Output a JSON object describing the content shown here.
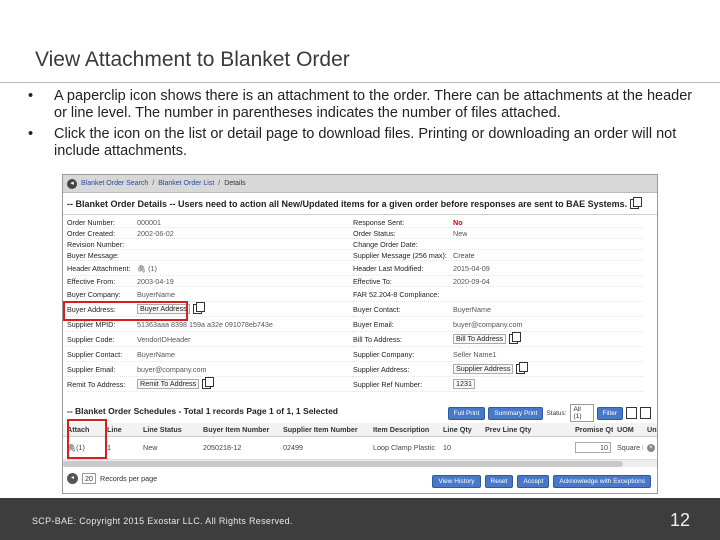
{
  "slide": {
    "title": "View Attachment to Blanket Order",
    "bullets": [
      "A paperclip icon shows there is an attachment to the order.  There can be attachments at the header or line level.  The number in parentheses indicates the number of files attached.",
      "Click the icon on the list or detail page to download files.  Printing or downloading an order will not include attachments."
    ],
    "footer": "SCP-BAE:  Copyright 2015 Exostar LLC. All Rights Reserved.",
    "page_number": "12"
  },
  "app": {
    "breadcrumb": [
      "Blanket Order Search",
      "Blanket Order List",
      "Details"
    ],
    "header_title": "-- Blanket Order Details -- Users need to action all New/Updated items for a given order before responses are sent to BAE Systems.",
    "left_fields": [
      {
        "label": "Order Number:",
        "value": "000001"
      },
      {
        "label": "Order Created:",
        "value": "2002-06-02"
      },
      {
        "label": "Revision Number:",
        "value": ""
      },
      {
        "label": "Buyer Message:",
        "value": ""
      },
      {
        "label": "Header Attachment:",
        "value": "(1)"
      },
      {
        "label": "Effective From:",
        "value": "2003-04-19"
      },
      {
        "label": "Buyer Company:",
        "value": "BuyerName"
      },
      {
        "label": "Buyer Address:",
        "value": "Buyer Address"
      },
      {
        "label": "Supplier MPID:",
        "value": "51363aaa 8398 159a a32e 091078eb743e"
      },
      {
        "label": "Supplier Code:",
        "value": "VendorIDHeader"
      },
      {
        "label": "Supplier Contact:",
        "value": "BuyerName"
      },
      {
        "label": "Supplier Email:",
        "value": "buyer@company.com"
      },
      {
        "label": "Remit To Address:",
        "value": "Remit To Address"
      }
    ],
    "right_fields": [
      {
        "label": "Response Sent:",
        "value": "No"
      },
      {
        "label": "Order Status:",
        "value": "New"
      },
      {
        "label": "Change Order Date:",
        "value": ""
      },
      {
        "label": "Supplier Message (256 max):",
        "value": "Create"
      },
      {
        "label": "Header Last Modified:",
        "value": "2015-04-09"
      },
      {
        "label": "Effective To:",
        "value": "2020-09-04"
      },
      {
        "label": "FAR 52.204-8 Compliance:",
        "value": ""
      },
      {
        "label": "Buyer Contact:",
        "value": "BuyerName"
      },
      {
        "label": "Buyer Email:",
        "value": "buyer@company.com"
      },
      {
        "label": "Bill To Address:",
        "value": "Bill To Address"
      },
      {
        "label": "Supplier Company:",
        "value": "Seller Name1"
      },
      {
        "label": "Supplier Address:",
        "value": "Supplier Address"
      },
      {
        "label": "Supplier Ref Number:",
        "value": "1231"
      }
    ],
    "schedules": {
      "title": "-- Blanket Order Schedules - Total 1 records Page 1 of 1, 1 Selected",
      "full_print": "Full Print",
      "summary_print": "Summary Print",
      "status_label": "Status:",
      "status_value": "All (1)",
      "filter": "Filter",
      "columns": [
        "Attach",
        "Line",
        "Line Status",
        "Buyer Item Number",
        "Supplier Item Number",
        "Item Description",
        "Line Qty",
        "Prev Line Qty",
        "Promise Qty",
        "UOM",
        "Unit"
      ],
      "row": {
        "attach": "(1)",
        "line": "1",
        "status": "New",
        "buyer_item": "2050218-12",
        "supplier_item": "02499",
        "description": "Loop Clamp Plastic",
        "line_qty": "10",
        "prev_qty": "",
        "promise_qty": "10",
        "uom": "Square Foot",
        "unit": ""
      },
      "page_size": "20",
      "records_label": "Records per page",
      "page_indicator": "1",
      "view_history": "View History",
      "reset": "Reset",
      "accept": "Accept",
      "ack_exceptions": "Acknowledge with Exceptions"
    }
  },
  "colors": {
    "highlight": "#d62020",
    "button": "#4a78c9",
    "link": "#1f4d9a",
    "footer": "#3d3d3d"
  }
}
